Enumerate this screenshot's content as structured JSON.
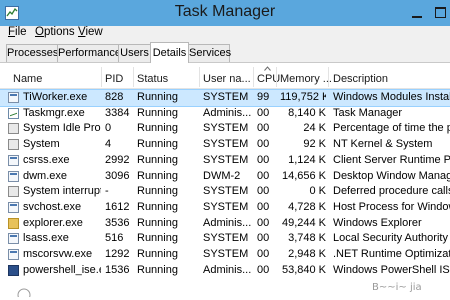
{
  "window": {
    "title": "Task Manager"
  },
  "menu": [
    {
      "label": "File",
      "key": "F"
    },
    {
      "label": "Options",
      "key": "O"
    },
    {
      "label": "View",
      "key": "V"
    }
  ],
  "tabs": [
    "Processes",
    "Performance",
    "Users",
    "Details",
    "Services"
  ],
  "active_tab": "Details",
  "columns": {
    "name": "Name",
    "pid": "PID",
    "status": "Status",
    "user": "User na...",
    "cpu": "CPU",
    "memory": "Memory ...",
    "description": "Description"
  },
  "rows": [
    {
      "icon": "generic-process-icon",
      "name": "TiWorker.exe",
      "pid": "828",
      "status": "Running",
      "user": "SYSTEM",
      "cpu": "99",
      "memory": "119,752 K",
      "description": "Windows Modules Installer"
    },
    {
      "icon": "task-manager-icon",
      "name": "Taskmgr.exe",
      "pid": "3384",
      "status": "Running",
      "user": "Adminis...",
      "cpu": "00",
      "memory": "8,140 K",
      "description": "Task Manager"
    },
    {
      "icon": "system-idle-icon",
      "name": "System Idle Pro...",
      "pid": "0",
      "status": "Running",
      "user": "SYSTEM",
      "cpu": "00",
      "memory": "24 K",
      "description": "Percentage of time the proc"
    },
    {
      "icon": "system-icon",
      "name": "System",
      "pid": "4",
      "status": "Running",
      "user": "SYSTEM",
      "cpu": "00",
      "memory": "92 K",
      "description": "NT Kernel & System"
    },
    {
      "icon": "generic-process-icon",
      "name": "csrss.exe",
      "pid": "2992",
      "status": "Running",
      "user": "SYSTEM",
      "cpu": "00",
      "memory": "1,124 K",
      "description": "Client Server Runtime Proce"
    },
    {
      "icon": "generic-process-icon",
      "name": "dwm.exe",
      "pid": "3096",
      "status": "Running",
      "user": "DWM-2",
      "cpu": "00",
      "memory": "14,656 K",
      "description": "Desktop Window Manager"
    },
    {
      "icon": "system-interrupts-icon",
      "name": "System interrupts",
      "pid": "-",
      "status": "Running",
      "user": "SYSTEM",
      "cpu": "00",
      "memory": "0 K",
      "description": "Deferred procedure calls an"
    },
    {
      "icon": "generic-process-icon",
      "name": "svchost.exe",
      "pid": "1612",
      "status": "Running",
      "user": "SYSTEM",
      "cpu": "00",
      "memory": "4,728 K",
      "description": "Host Process for Windows S"
    },
    {
      "icon": "folder-icon",
      "name": "explorer.exe",
      "pid": "3536",
      "status": "Running",
      "user": "Adminis...",
      "cpu": "00",
      "memory": "49,244 K",
      "description": "Windows Explorer"
    },
    {
      "icon": "generic-process-icon",
      "name": "lsass.exe",
      "pid": "516",
      "status": "Running",
      "user": "SYSTEM",
      "cpu": "00",
      "memory": "3,748 K",
      "description": "Local Security Authority Pro"
    },
    {
      "icon": "generic-process-icon",
      "name": "mscorsvw.exe",
      "pid": "1292",
      "status": "Running",
      "user": "SYSTEM",
      "cpu": "00",
      "memory": "2,948 K",
      "description": ".NET Runtime Optimization S"
    },
    {
      "icon": "powershell-icon",
      "name": "powershell_ise.e...",
      "pid": "1536",
      "status": "Running",
      "user": "Adminis...",
      "cpu": "00",
      "memory": "53,840 K",
      "description": "Windows PowerShell ISE"
    }
  ],
  "selected_row": 0,
  "watermark": "B~~i~ jia"
}
